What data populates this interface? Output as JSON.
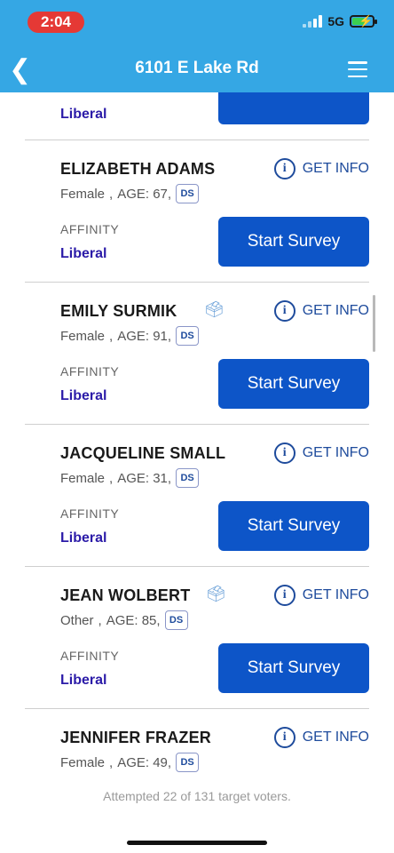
{
  "status_bar": {
    "time": "2:04",
    "network": "5G"
  },
  "header": {
    "title": "6101 E Lake Rd"
  },
  "partial_card": {
    "affinity": "Liberal"
  },
  "affinity_label": "AFFINITY",
  "get_info_label": "GET INFO",
  "start_survey_label": "Start Survey",
  "ds_label": "DS",
  "voters": [
    {
      "name": "ELIZABETH ADAMS",
      "gender": "Female",
      "age_text": "AGE: 67,",
      "affinity": "Liberal",
      "ballot": false
    },
    {
      "name": "EMILY SURMIK",
      "gender": "Female",
      "age_text": "AGE: 91,",
      "affinity": "Liberal",
      "ballot": true
    },
    {
      "name": "JACQUELINE SMALL",
      "gender": "Female",
      "age_text": "AGE: 31,",
      "affinity": "Liberal",
      "ballot": false
    },
    {
      "name": "JEAN WOLBERT",
      "gender": "Other",
      "age_text": "AGE: 85,",
      "affinity": "Liberal",
      "ballot": true
    },
    {
      "name": "JENNIFER FRAZER",
      "gender": "Female",
      "age_text": "AGE: 49,",
      "affinity": "",
      "ballot": false
    }
  ],
  "footer": {
    "progress_text": "Attempted 22 of 131 target voters."
  }
}
